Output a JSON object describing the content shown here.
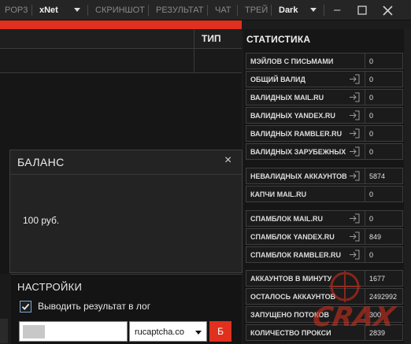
{
  "menubar": {
    "pop3": "POP3",
    "engine": "xNet",
    "screenshot": "СКРИНШОТ",
    "result": "РЕЗУЛЬТАТ",
    "chat": "ЧАТ",
    "tray": "ТРЕЙ",
    "theme": "Dark",
    "minimize_glyph": "–"
  },
  "table": {
    "col_type": "ТИП"
  },
  "stats": {
    "title": "СТАТИСТИКА",
    "rows": [
      {
        "label": "МЭЙЛОВ С ПИСЬМАМИ",
        "value": "0",
        "icon": false
      },
      {
        "label": "ОБЩИЙ ВАЛИД",
        "value": "0",
        "icon": true
      },
      {
        "label": "ВАЛИДНЫХ MAIL.RU",
        "value": "0",
        "icon": true
      },
      {
        "label": "ВАЛИДНЫХ YANDEX.RU",
        "value": "0",
        "icon": true
      },
      {
        "label": "ВАЛИДНЫХ RAMBLER.RU",
        "value": "0",
        "icon": true
      },
      {
        "label": "ВАЛИДНЫХ ЗАРУБЕЖНЫХ",
        "value": "0",
        "icon": true
      },
      {
        "label": "НЕВАЛИДНЫХ АККАУНТОВ",
        "value": "5874",
        "icon": true
      },
      {
        "label": "КАПЧИ MAIL.RU",
        "value": "0",
        "icon": false
      },
      {
        "label": "СПАМБЛОК MAIL.RU",
        "value": "0",
        "icon": true
      },
      {
        "label": "СПАМБЛОК YANDEX.RU",
        "value": "849",
        "icon": true
      },
      {
        "label": "СПАМБЛОК RAMBLER.RU",
        "value": "0",
        "icon": true
      },
      {
        "label": "АККАУНТОВ В МИНУТУ",
        "value": "1677",
        "icon": false
      },
      {
        "label": "ОСТАЛОСЬ АККАУНТОВ",
        "value": "2492992",
        "icon": false
      },
      {
        "label": "ЗАПУЩЕНО ПОТОКОВ",
        "value": "300",
        "icon": false
      },
      {
        "label": "КОЛИЧЕСТВО ПРОКСИ",
        "value": "2839",
        "icon": false
      }
    ]
  },
  "dialog": {
    "title": "БАЛАНС",
    "close_glyph": "×",
    "amount": "100 руб."
  },
  "settings": {
    "title": "НАСТРОЙКИ",
    "log_checkbox_label": "Выводить результат в лог",
    "log_checked": true,
    "api_key_value": "",
    "captcha_service": "rucaptcha.co",
    "balance_button": "Б"
  },
  "colors": {
    "accent": "#e0301e",
    "background": "#1c1c1c",
    "checkbox": "#7aa7d8"
  },
  "watermark": "CRAX"
}
